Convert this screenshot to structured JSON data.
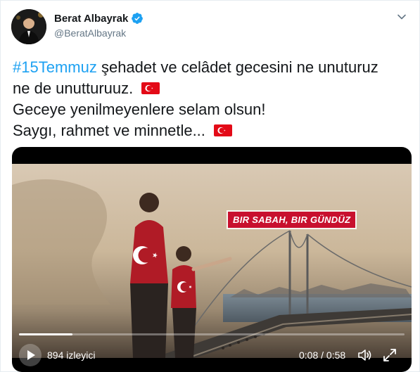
{
  "author": {
    "display_name": "Berat Albayrak",
    "handle": "@BeratAlbayrak",
    "verified_icon": "verified-badge-icon",
    "avatar_icon": "avatar"
  },
  "tweet": {
    "line1_hashtag": "#15Temmuz",
    "line1_text": " şehadet ve celâdet gecesini ne unuturuz",
    "line2_text": "ne de unutturuuz.",
    "line3_text": "Geceye yenilmeyenlere selam olsun!",
    "line4_text": "Saygı, rahmet ve minnetle...",
    "flag_icon": "turkish-flag-icon"
  },
  "video": {
    "overlay_text": "BIR SABAH, BIR GÜNDÜZ",
    "views_label": "894 izleyici",
    "time_label": "0:08 / 0:58",
    "progress_fraction": 0.138,
    "icons": {
      "play": "play-icon",
      "volume": "volume-icon",
      "fullscreen": "fullscreen-icon",
      "menu": "chevron-down-icon"
    }
  },
  "colors": {
    "link": "#1da1f2",
    "text": "#14171a",
    "secondary": "#657786",
    "flag_red": "#e30a17"
  }
}
